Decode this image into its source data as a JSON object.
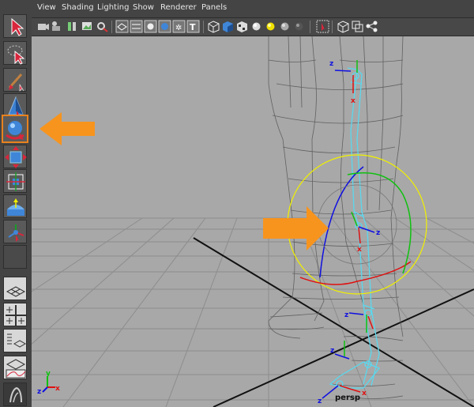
{
  "menubar": {
    "items": [
      "View",
      "Shading",
      "Lighting",
      "Show",
      "Renderer",
      "Panels"
    ]
  },
  "viewport": {
    "camera_label": "persp",
    "axis_labels": {
      "z": "z",
      "x": "x",
      "y": "y"
    }
  },
  "colors": {
    "accent_orange": "#f7941d",
    "active_tool_border": "#e8821e",
    "skeleton": "#5ad8ee",
    "manipulator_ring": "#f0f000",
    "axis_x": "#e01010",
    "axis_y": "#10c010",
    "axis_z": "#1010e0"
  },
  "icons": {
    "toolbox": [
      "select-arrow-icon",
      "lasso-select-icon",
      "paint-select-icon",
      "move-tool-icon",
      "rotate-tool-icon",
      "scale-tool-icon",
      "universal-manipulator-icon",
      "soft-mod-icon",
      "show-manipulator-icon",
      "last-tool-icon"
    ]
  }
}
